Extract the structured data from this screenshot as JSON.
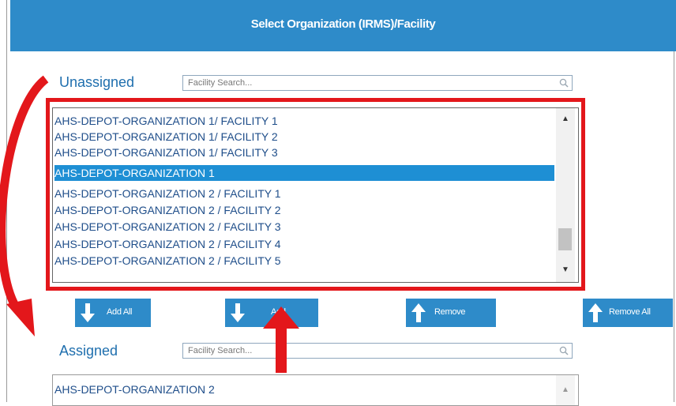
{
  "header": {
    "title": "Select Organization (IRMS)/Facility"
  },
  "unassigned": {
    "label": "Unassigned",
    "search_placeholder": "Facility Search...",
    "items": [
      {
        "label": "AHS-DEPOT-ORGANIZATION 1/ FACILITY 1",
        "selected": false
      },
      {
        "label": "AHS-DEPOT-ORGANIZATION 1/ FACILITY 2",
        "selected": false
      },
      {
        "label": "AHS-DEPOT-ORGANIZATION 1/ FACILITY 3",
        "selected": false
      },
      {
        "label": "AHS-DEPOT-ORGANIZATION 1",
        "selected": true
      },
      {
        "label": "AHS-DEPOT-ORGANIZATION 2 / FACILITY 1",
        "selected": false
      },
      {
        "label": "AHS-DEPOT-ORGANIZATION 2 / FACILITY 2",
        "selected": false
      },
      {
        "label": "AHS-DEPOT-ORGANIZATION 2 / FACILITY 3",
        "selected": false
      },
      {
        "label": "AHS-DEPOT-ORGANIZATION 2 / FACILITY 4",
        "selected": false
      },
      {
        "label": "AHS-DEPOT-ORGANIZATION 2 / FACILITY 5",
        "selected": false
      }
    ]
  },
  "buttons": {
    "add_all": "Add All",
    "add": "Add",
    "remove": "Remove",
    "remove_all": "Remove All"
  },
  "assigned": {
    "label": "Assigned",
    "search_placeholder": "Facility Search...",
    "items": [
      {
        "label": "AHS-DEPOT-ORGANIZATION 2",
        "selected": false
      }
    ]
  },
  "colors": {
    "accent": "#2e8bc9",
    "highlight_frame": "#e3171b",
    "selection": "#1e8fd4",
    "label_blue": "#1f6fae"
  },
  "icons": [
    "search-icon",
    "arrow-down-icon",
    "arrow-up-icon",
    "scroll-up-icon",
    "scroll-down-icon",
    "callout-arrow-icon"
  ]
}
